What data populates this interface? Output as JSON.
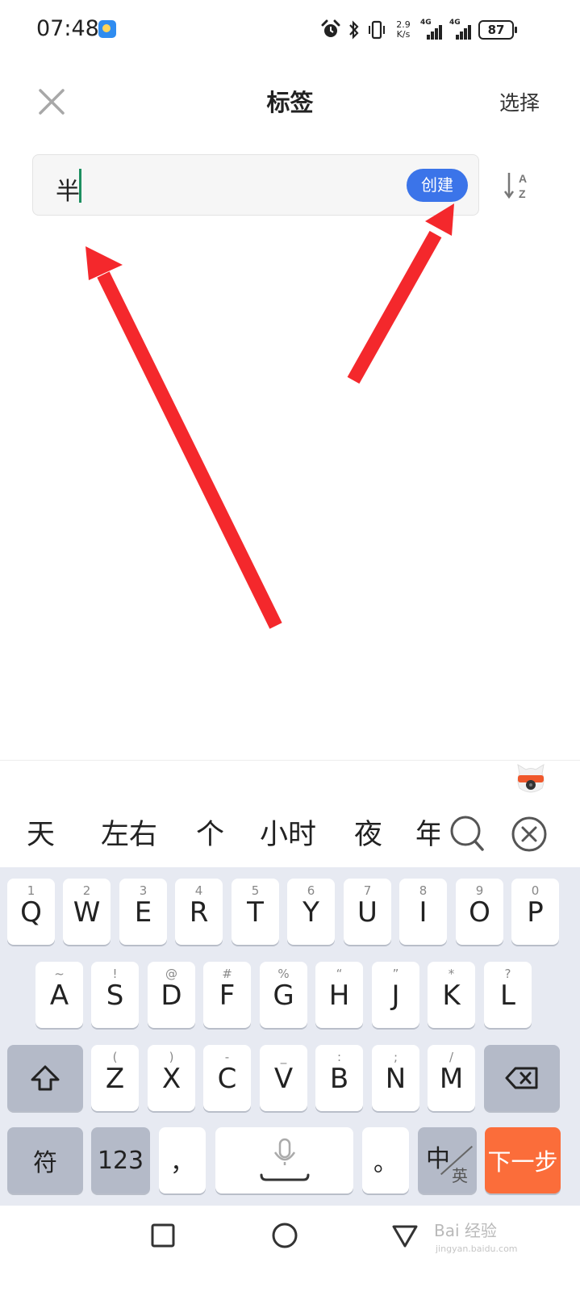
{
  "status_bar": {
    "time": "07:48",
    "speed_top": "2.9",
    "speed_bottom": "K/s",
    "network_1": "4G",
    "network_2": "4G",
    "battery": "87"
  },
  "header": {
    "title": "标签",
    "select_label": "选择",
    "close_icon": "close-icon"
  },
  "tag_input": {
    "value": "半",
    "create_label": "创建",
    "sort_icon": "sort-a-z-icon"
  },
  "annotations": {
    "arrow_color": "#f4282c",
    "count": 2
  },
  "ime": {
    "candidates": [
      "天",
      "左右",
      "个",
      "小时",
      "夜",
      "年"
    ],
    "search_icon": "search-icon",
    "clear_icon": "clear-candidates-icon"
  },
  "keyboard": {
    "row1": [
      {
        "sub": "1",
        "main": "Q"
      },
      {
        "sub": "2",
        "main": "W"
      },
      {
        "sub": "3",
        "main": "E"
      },
      {
        "sub": "4",
        "main": "R"
      },
      {
        "sub": "5",
        "main": "T"
      },
      {
        "sub": "6",
        "main": "Y"
      },
      {
        "sub": "7",
        "main": "U"
      },
      {
        "sub": "8",
        "main": "I"
      },
      {
        "sub": "9",
        "main": "O"
      },
      {
        "sub": "0",
        "main": "P"
      }
    ],
    "row2": [
      {
        "sub": "~",
        "main": "A"
      },
      {
        "sub": "!",
        "main": "S"
      },
      {
        "sub": "@",
        "main": "D"
      },
      {
        "sub": "#",
        "main": "F"
      },
      {
        "sub": "%",
        "main": "G"
      },
      {
        "sub": "“",
        "main": "H"
      },
      {
        "sub": "”",
        "main": "J"
      },
      {
        "sub": "*",
        "main": "K"
      },
      {
        "sub": "?",
        "main": "L"
      }
    ],
    "row3": [
      {
        "sub": "(",
        "main": "Z"
      },
      {
        "sub": ")",
        "main": "X"
      },
      {
        "sub": "-",
        "main": "C"
      },
      {
        "sub": "_",
        "main": "V"
      },
      {
        "sub": ":",
        "main": "B"
      },
      {
        "sub": ";",
        "main": "N"
      },
      {
        "sub": "/",
        "main": "M"
      }
    ],
    "symbols_label": "符",
    "numbers_label": "123",
    "comma_label": "，",
    "period_label": "。",
    "lang_top": "中",
    "lang_bottom": "英",
    "next_label": "下一步",
    "accent_color": "#fb6d3a"
  },
  "nav_bar": {
    "recent_icon": "square-recents-icon",
    "home_icon": "circle-home-icon",
    "back_icon": "triangle-back-icon"
  },
  "watermark": {
    "text": "Bai 经验",
    "url": "jingyan.baidu.com"
  }
}
